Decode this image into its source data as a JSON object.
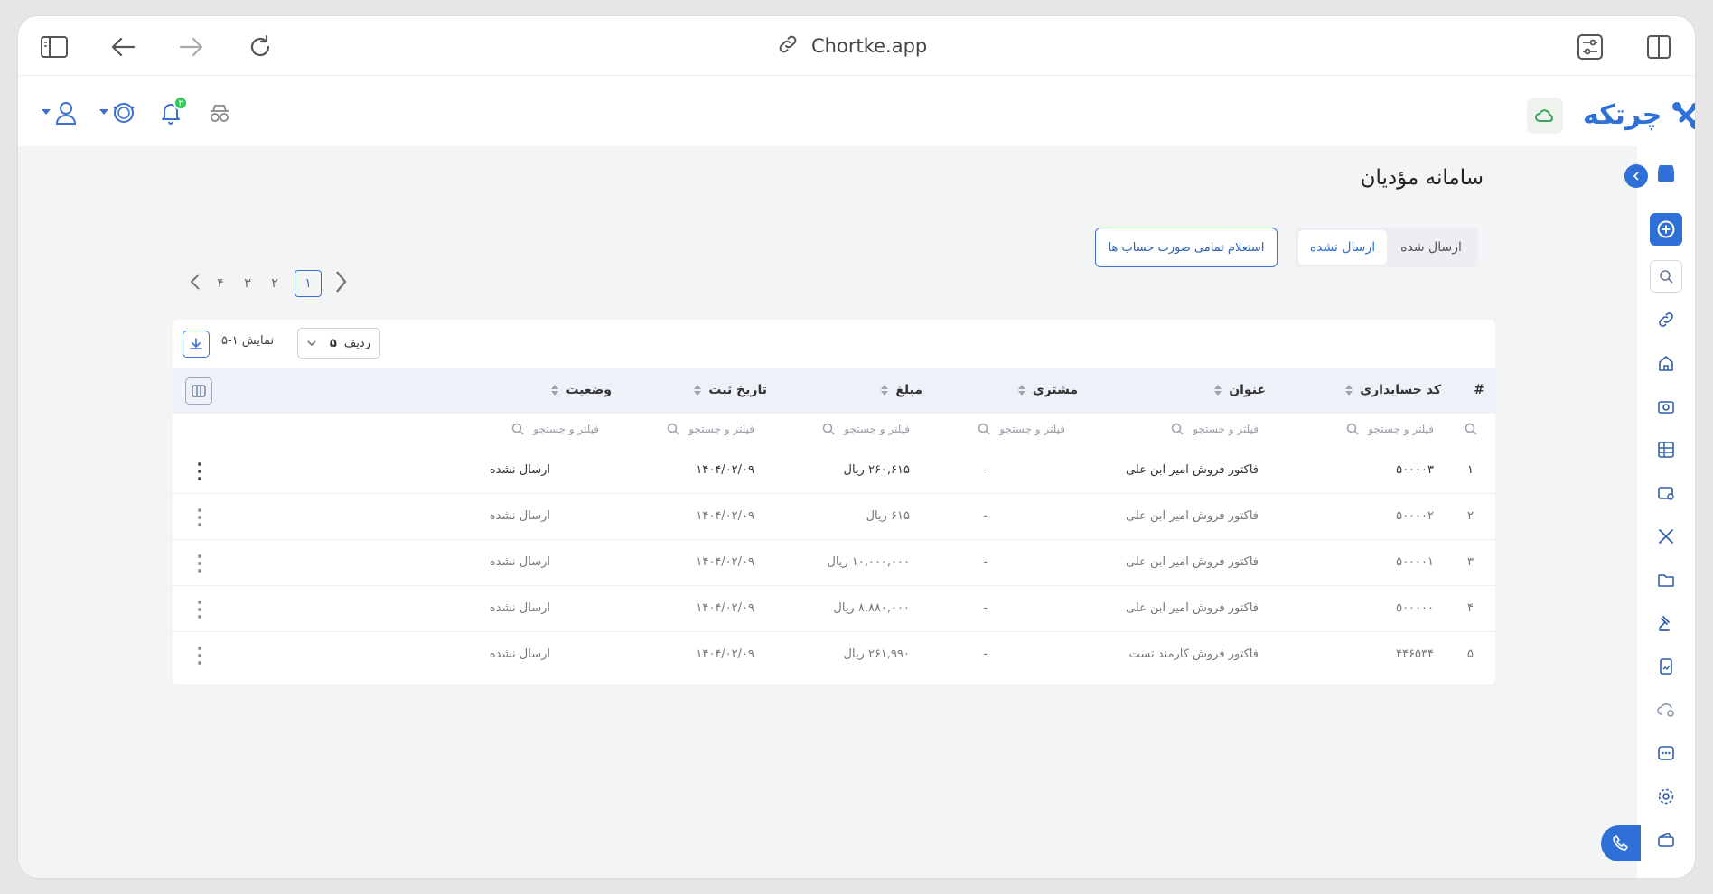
{
  "browser": {
    "url": "Chortke.app"
  },
  "header": {
    "logo_text": "چرتکه",
    "notification_count": "۲"
  },
  "page": {
    "title": "سامانه مؤدیان"
  },
  "tabs": [
    {
      "label": "ارسال شده",
      "active": false
    },
    {
      "label": "ارسال نشده",
      "active": true
    }
  ],
  "inquiry_button": "استعلام تمامی صورت حساب ها",
  "pagination": {
    "pages": [
      "۱",
      "۲",
      "۳",
      "۴"
    ],
    "current": "۱"
  },
  "table": {
    "rows_label": "ردیف",
    "rows_value": "۵",
    "showing": "نمایش ۱-۵",
    "filter_placeholder": "فیلتر و جستجو",
    "columns": [
      "#",
      "کد حسابداری",
      "عنوان",
      "مشتری",
      "مبلغ",
      "تاریخ ثبت",
      "وضعیت"
    ],
    "rows": [
      {
        "index": "۱",
        "code": "۵۰۰۰۰۳",
        "title": "فاکتور فروش امیر ابن علی",
        "customer": "-",
        "amount": "۲۶۰,۶۱۵ ریال",
        "date": "۱۴۰۴/۰۲/۰۹",
        "status": "ارسال نشده"
      },
      {
        "index": "۲",
        "code": "۵۰۰۰۰۲",
        "title": "فاکتور فروش امیر ابن علی",
        "customer": "-",
        "amount": "۶۱۵ ریال",
        "date": "۱۴۰۴/۰۲/۰۹",
        "status": "ارسال نشده"
      },
      {
        "index": "۳",
        "code": "۵۰۰۰۰۱",
        "title": "فاکتور فروش امیر ابن علی",
        "customer": "-",
        "amount": "۱۰,۰۰۰,۰۰۰ ریال",
        "date": "۱۴۰۴/۰۲/۰۹",
        "status": "ارسال نشده"
      },
      {
        "index": "۴",
        "code": "۵۰۰۰۰۰",
        "title": "فاکتور فروش امیر ابن علی",
        "customer": "-",
        "amount": "۸,۸۸۰,۰۰۰ ریال",
        "date": "۱۴۰۴/۰۲/۰۹",
        "status": "ارسال نشده"
      },
      {
        "index": "۵",
        "code": "۴۴۶۵۳۴",
        "title": "فاکتور فروش کارمند تست",
        "customer": "-",
        "amount": "۲۶۱,۹۹۰ ریال",
        "date": "۱۴۰۴/۰۲/۰۹",
        "status": "ارسال نشده"
      }
    ]
  },
  "colors": {
    "accent": "#2f6fd8",
    "header_bg": "#eef1f8",
    "page_bg": "#f3f4f6",
    "badge": "#34c759"
  },
  "icons": {
    "browser": [
      "sidebar-toggle-icon",
      "back-arrow-icon",
      "forward-arrow-icon",
      "reload-icon",
      "link-icon",
      "settings-sliders-icon",
      "split-view-icon"
    ],
    "header": [
      "user-icon",
      "coin-icon",
      "bell-icon",
      "incognito-icon",
      "cloud-icon",
      "logo-icon"
    ],
    "rail": [
      "store-icon",
      "plus-circle-icon",
      "search-icon",
      "link-icon",
      "home-icon",
      "camera-icon",
      "table-icon",
      "wallet-icon",
      "tools-icon",
      "folder-icon",
      "gavel-icon",
      "report-icon",
      "cloud-settings-icon",
      "dots-icon",
      "gear-icon",
      "wallet-alt-icon"
    ]
  }
}
